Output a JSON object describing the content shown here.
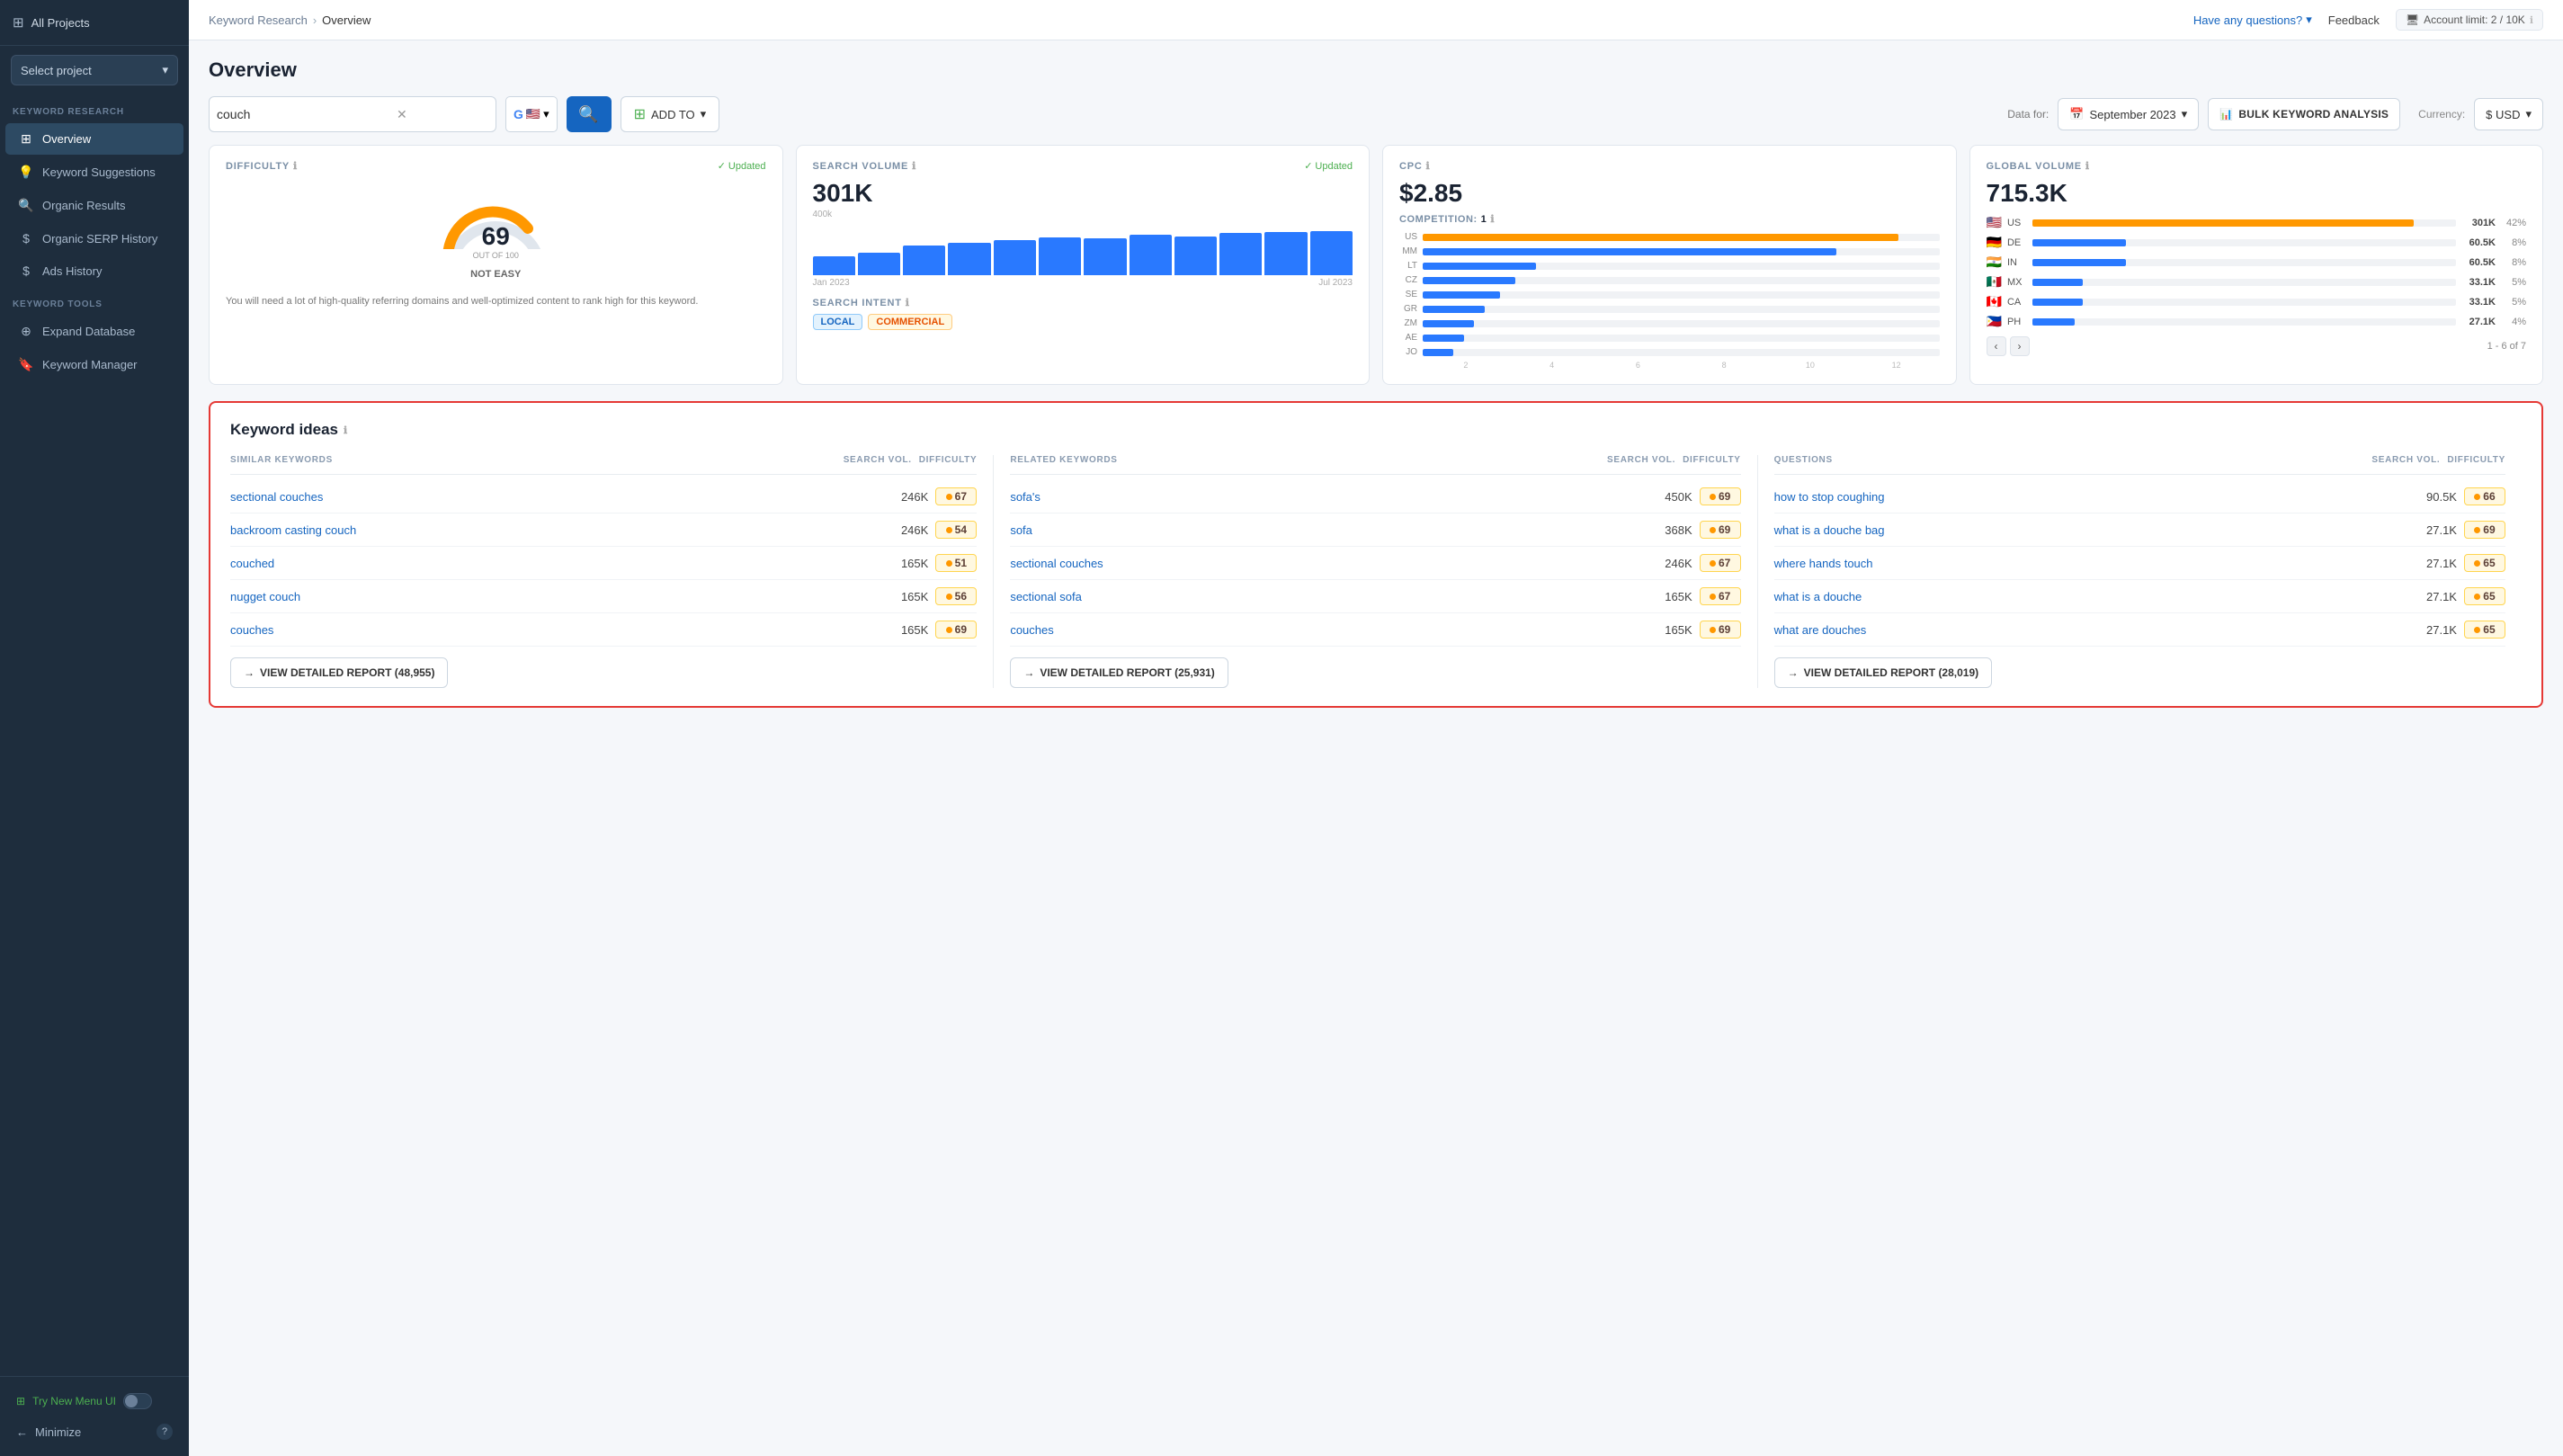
{
  "sidebar": {
    "all_projects": "All Projects",
    "select_project": "Select project",
    "sections": [
      {
        "label": "KEYWORD RESEARCH",
        "items": [
          {
            "id": "overview",
            "label": "Overview",
            "icon": "⊞",
            "active": true
          },
          {
            "id": "keyword-suggestions",
            "label": "Keyword Suggestions",
            "icon": "💡",
            "active": false
          },
          {
            "id": "organic-results",
            "label": "Organic Results",
            "icon": "🔍",
            "active": false
          },
          {
            "id": "organic-serp-history",
            "label": "Organic SERP History",
            "icon": "$",
            "active": false
          },
          {
            "id": "ads-history",
            "label": "Ads History",
            "icon": "$",
            "active": false
          }
        ]
      },
      {
        "label": "KEYWORD TOOLS",
        "items": [
          {
            "id": "expand-database",
            "label": "Expand Database",
            "icon": "⊕",
            "active": false
          },
          {
            "id": "keyword-manager",
            "label": "Keyword Manager",
            "icon": "🔖",
            "active": false
          }
        ]
      }
    ],
    "try_new_ui": "Try New Menu UI",
    "minimize": "Minimize"
  },
  "topbar": {
    "breadcrumb1": "Keyword Research",
    "breadcrumb2": "Overview",
    "have_questions": "Have any questions?",
    "feedback": "Feedback",
    "account_limit": "Account limit: 2 / 10K"
  },
  "main": {
    "title": "Overview",
    "search_value": "couch",
    "add_to": "ADD TO",
    "data_for_label": "Data for:",
    "data_for_value": "September 2023",
    "currency_label": "Currency:",
    "currency_value": "$ USD",
    "bulk_btn": "BULK KEYWORD ANALYSIS"
  },
  "difficulty": {
    "title": "DIFFICULTY",
    "updated": "Updated",
    "value": 69,
    "out_of": "OUT OF 100",
    "label": "NOT EASY",
    "description": "You will need a lot of high-quality referring domains and well-optimized content to rank high for this keyword."
  },
  "search_volume": {
    "title": "SEARCH VOLUME",
    "updated": "Updated",
    "value": "301K",
    "scale": "400k",
    "bars": [
      35,
      42,
      55,
      60,
      65,
      70,
      68,
      75,
      72,
      78,
      80,
      82
    ],
    "label_start": "Jan 2023",
    "label_end": "Jul 2023",
    "intent_title": "SEARCH INTENT",
    "badges": [
      "LOCAL",
      "COMMERCIAL"
    ]
  },
  "cpc": {
    "title": "CPC",
    "value": "$2.85",
    "competition_label": "COMPETITION:",
    "competition_value": "1",
    "countries": [
      {
        "code": "US",
        "pct": 92,
        "type": "orange"
      },
      {
        "code": "MM",
        "pct": 80,
        "type": "blue"
      },
      {
        "code": "LT",
        "pct": 22,
        "type": "blue"
      },
      {
        "code": "CZ",
        "pct": 18,
        "type": "blue"
      },
      {
        "code": "SE",
        "pct": 15,
        "type": "blue"
      },
      {
        "code": "GR",
        "pct": 12,
        "type": "blue"
      },
      {
        "code": "ZM",
        "pct": 10,
        "type": "blue"
      },
      {
        "code": "AE",
        "pct": 8,
        "type": "blue"
      },
      {
        "code": "JO",
        "pct": 6,
        "type": "blue"
      }
    ],
    "axis": [
      "2",
      "4",
      "6",
      "8",
      "10",
      "12"
    ]
  },
  "global_volume": {
    "title": "GLOBAL VOLUME",
    "value": "715.3K",
    "countries": [
      {
        "code": "US",
        "flag": "🇺🇸",
        "bar_pct": 90,
        "bar_type": "orange",
        "vol": "301K",
        "pct": "42%"
      },
      {
        "code": "DE",
        "flag": "🇩🇪",
        "bar_pct": 22,
        "bar_type": "blue",
        "vol": "60.5K",
        "pct": "8%"
      },
      {
        "code": "IN",
        "flag": "🇮🇳",
        "bar_pct": 22,
        "bar_type": "blue",
        "vol": "60.5K",
        "pct": "8%"
      },
      {
        "code": "MX",
        "flag": "🇲🇽",
        "bar_pct": 12,
        "bar_type": "blue",
        "vol": "33.1K",
        "pct": "5%"
      },
      {
        "code": "CA",
        "flag": "🇨🇦",
        "bar_pct": 12,
        "bar_type": "blue",
        "vol": "33.1K",
        "pct": "5%"
      },
      {
        "code": "PH",
        "flag": "🇵🇭",
        "bar_pct": 10,
        "bar_type": "blue",
        "vol": "27.1K",
        "pct": "4%"
      }
    ],
    "pagination": "1 - 6 of 7"
  },
  "keyword_ideas": {
    "title": "Keyword ideas",
    "columns": [
      {
        "id": "similar",
        "header": "SIMILAR KEYWORDS",
        "sv_header": "SEARCH VOL.",
        "diff_header": "DIFFICULTY",
        "rows": [
          {
            "keyword": "sectional couches",
            "vol": "246K",
            "diff": 67
          },
          {
            "keyword": "backroom casting couch",
            "vol": "246K",
            "diff": 54
          },
          {
            "keyword": "couched",
            "vol": "165K",
            "diff": 51
          },
          {
            "keyword": "nugget couch",
            "vol": "165K",
            "diff": 56
          },
          {
            "keyword": "couches",
            "vol": "165K",
            "diff": 69
          }
        ],
        "report_btn": "VIEW DETAILED REPORT (48,955)"
      },
      {
        "id": "related",
        "header": "RELATED KEYWORDS",
        "sv_header": "SEARCH VOL.",
        "diff_header": "DIFFICULTY",
        "rows": [
          {
            "keyword": "sofa's",
            "vol": "450K",
            "diff": 69
          },
          {
            "keyword": "sofa",
            "vol": "368K",
            "diff": 69
          },
          {
            "keyword": "sectional couches",
            "vol": "246K",
            "diff": 67
          },
          {
            "keyword": "sectional sofa",
            "vol": "165K",
            "diff": 67
          },
          {
            "keyword": "couches",
            "vol": "165K",
            "diff": 69
          }
        ],
        "report_btn": "VIEW DETAILED REPORT (25,931)"
      },
      {
        "id": "questions",
        "header": "QUESTIONS",
        "sv_header": "SEARCH VOL.",
        "diff_header": "DIFFICULTY",
        "rows": [
          {
            "keyword": "how to stop coughing",
            "vol": "90.5K",
            "diff": 66
          },
          {
            "keyword": "what is a douche bag",
            "vol": "27.1K",
            "diff": 69
          },
          {
            "keyword": "where hands touch",
            "vol": "27.1K",
            "diff": 65
          },
          {
            "keyword": "what is a douche",
            "vol": "27.1K",
            "diff": 65
          },
          {
            "keyword": "what are douches",
            "vol": "27.1K",
            "diff": 65
          }
        ],
        "report_btn": "VIEW DETAILED REPORT (28,019)"
      }
    ]
  }
}
